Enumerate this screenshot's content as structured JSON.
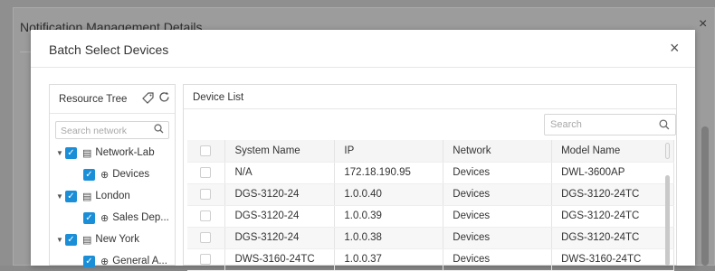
{
  "background": {
    "title": "Notification Management Details",
    "close_glyph": "×"
  },
  "modal": {
    "title": "Batch Select Devices",
    "close_glyph": "×"
  },
  "resource_tree": {
    "title": "Resource Tree",
    "tag_icon": "tag-icon",
    "refresh_icon": "refresh-icon",
    "search_placeholder": "Search network",
    "nodes": [
      {
        "label": "Network-Lab",
        "type": "site",
        "checked": true,
        "expanded": true
      },
      {
        "label": "Devices",
        "type": "network",
        "checked": true
      },
      {
        "label": "London",
        "type": "site",
        "checked": true,
        "expanded": true
      },
      {
        "label": "Sales Dep...",
        "type": "network",
        "checked": true
      },
      {
        "label": "New York",
        "type": "site",
        "checked": true,
        "expanded": true
      },
      {
        "label": "General A...",
        "type": "network",
        "checked": true
      }
    ]
  },
  "device_list": {
    "title": "Device List",
    "search_placeholder": "Search",
    "columns": [
      "System Name",
      "IP",
      "Network",
      "Model Name"
    ],
    "rows": [
      [
        "N/A",
        "172.18.190.95",
        "Devices",
        "DWL-3600AP"
      ],
      [
        "DGS-3120-24",
        "1.0.0.40",
        "Devices",
        "DGS-3120-24TC"
      ],
      [
        "DGS-3120-24",
        "1.0.0.39",
        "Devices",
        "DGS-3120-24TC"
      ],
      [
        "DGS-3120-24",
        "1.0.0.38",
        "Devices",
        "DGS-3120-24TC"
      ],
      [
        "DWS-3160-24TC",
        "1.0.0.37",
        "Devices",
        "DWS-3160-24TC"
      ]
    ]
  },
  "colors": {
    "accent": "#1a8fd8",
    "overlay": "#8f8f8f"
  }
}
